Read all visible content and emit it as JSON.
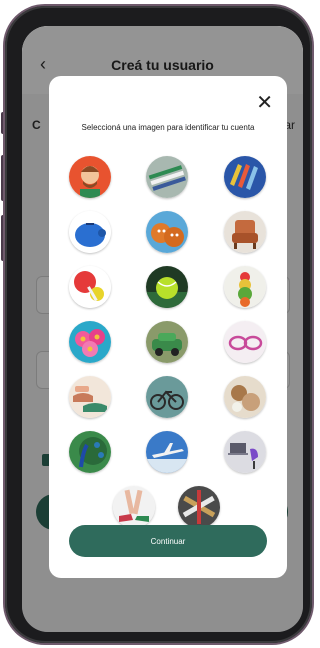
{
  "header": {
    "title": "Creá tu usuario",
    "back_icon": "chevron-left-icon"
  },
  "modal": {
    "prompt": "Seleccioná una imagen para identificar tu cuenta",
    "close_icon": "close-icon",
    "continue_label": "Continuar",
    "avatars": [
      {
        "id": "man-cartoon",
        "bg": "#e8532f"
      },
      {
        "id": "pencils-top",
        "bg": "#7a9a8a"
      },
      {
        "id": "pencils-blue",
        "bg": "#2a56a8"
      },
      {
        "id": "piggy-bank",
        "bg": "#2a6fd1"
      },
      {
        "id": "gingerbread-cookies",
        "bg": "#e07a2a"
      },
      {
        "id": "armchair",
        "bg": "#c46a3e"
      },
      {
        "id": "lollipop",
        "bg": "#e53a3a"
      },
      {
        "id": "tennis-ball",
        "bg": "#1f3a24"
      },
      {
        "id": "fruit-stack",
        "bg": "#e8e8e0"
      },
      {
        "id": "pink-flowers",
        "bg": "#2aa8c9"
      },
      {
        "id": "green-car",
        "bg": "#6b8a4a"
      },
      {
        "id": "sunglasses",
        "bg": "#f2e6ee"
      },
      {
        "id": "shoes",
        "bg": "#e8c8b0"
      },
      {
        "id": "bicycle",
        "bg": "#4a7a7a"
      },
      {
        "id": "seashells",
        "bg": "#d8c8b0"
      },
      {
        "id": "peacock",
        "bg": "#2f7a3a"
      },
      {
        "id": "airplane",
        "bg": "#2a62b0"
      },
      {
        "id": "desk-chair",
        "bg": "#d6d6da"
      },
      {
        "id": "legs-heels",
        "bg": "#f0f0f0"
      },
      {
        "id": "skateboards",
        "bg": "#4a4a4a"
      }
    ]
  },
  "colors": {
    "brand_green": "#2f6b5c",
    "overlay": "rgba(0,0,0,0.42)"
  }
}
